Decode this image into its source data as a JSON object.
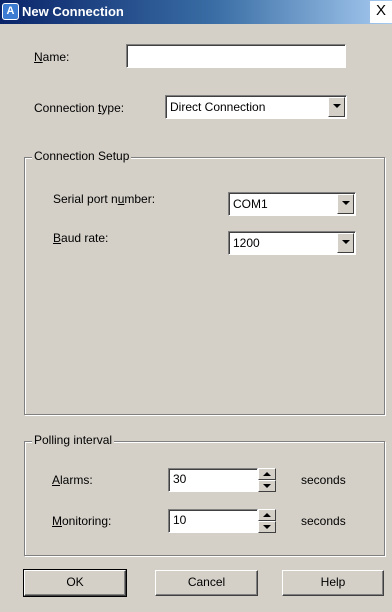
{
  "window": {
    "title": "New Connection",
    "close_symbol": "X",
    "icon": "app-icon"
  },
  "name": {
    "label_accel": "N",
    "label_rest": "ame:",
    "value": ""
  },
  "connection_type": {
    "label_pre": "Connection ",
    "label_accel": "t",
    "label_post": "ype:",
    "value": "Direct Connection"
  },
  "connection_setup": {
    "title": "Connection Setup",
    "serial_port": {
      "label_pre": "Serial port n",
      "label_accel": "u",
      "label_post": "mber:",
      "value": "COM1"
    },
    "baud_rate": {
      "label_accel": "B",
      "label_rest": "aud rate:",
      "value": "1200"
    }
  },
  "polling": {
    "title": "Polling interval",
    "alarms": {
      "label_accel": "A",
      "label_rest": "larms:",
      "value": "30",
      "unit": "seconds"
    },
    "monitoring": {
      "label_accel": "M",
      "label_rest": "onitoring:",
      "value": "10",
      "unit": "seconds"
    }
  },
  "buttons": {
    "ok": "OK",
    "cancel": "Cancel",
    "help": "Help"
  }
}
